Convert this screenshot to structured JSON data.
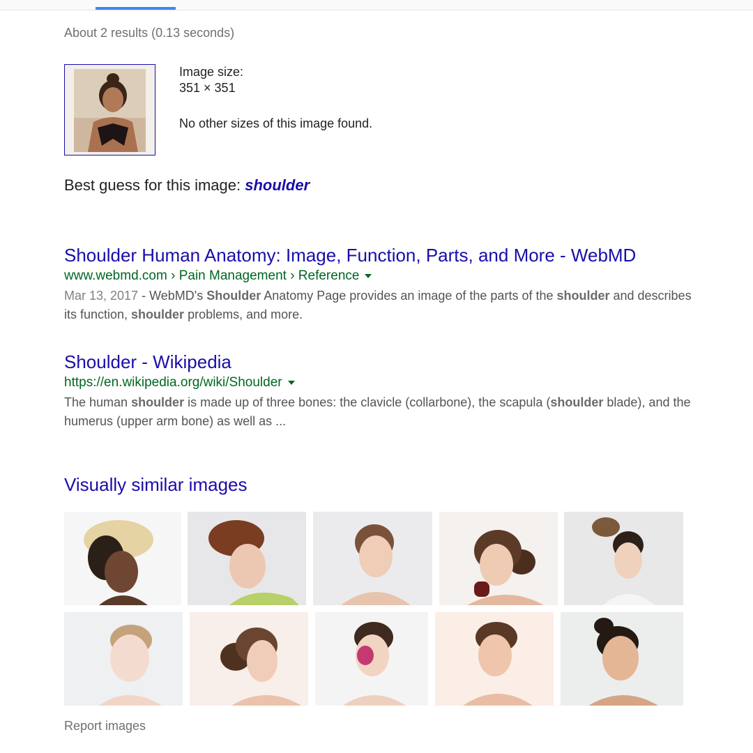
{
  "stats": "About 2 results (0.13 seconds)",
  "image_info": {
    "size_label": "Image size:",
    "size_value": "351 × 351",
    "other_sizes": "No other sizes of this image found."
  },
  "best_guess": {
    "prefix": "Best guess for this image: ",
    "term": "shoulder"
  },
  "results": [
    {
      "title": "Shoulder Human Anatomy: Image, Function, Parts, and More - WebMD",
      "url": "www.webmd.com › Pain Management › Reference",
      "date": "Mar 13, 2017",
      "snippet_parts": [
        " - WebMD's ",
        "Shoulder",
        " Anatomy Page provides an image of the parts of the ",
        "shoulder",
        " and describes its function, ",
        "shoulder",
        " problems, and more."
      ]
    },
    {
      "title": "Shoulder - Wikipedia",
      "url": "https://en.wikipedia.org/wiki/Shoulder",
      "snippet_parts": [
        "The human ",
        "shoulder",
        " is made up of three bones: the clavicle (collarbone), the scapula (",
        "shoulder",
        " blade), and the humerus (upper arm bone) as well as ..."
      ]
    }
  ],
  "similar_title": "Visually similar images",
  "report_label": "Report images",
  "colors": {
    "link": "#1a0dab",
    "url_green": "#006621",
    "snippet_gray": "#545454",
    "tab_blue": "#4285f4"
  }
}
